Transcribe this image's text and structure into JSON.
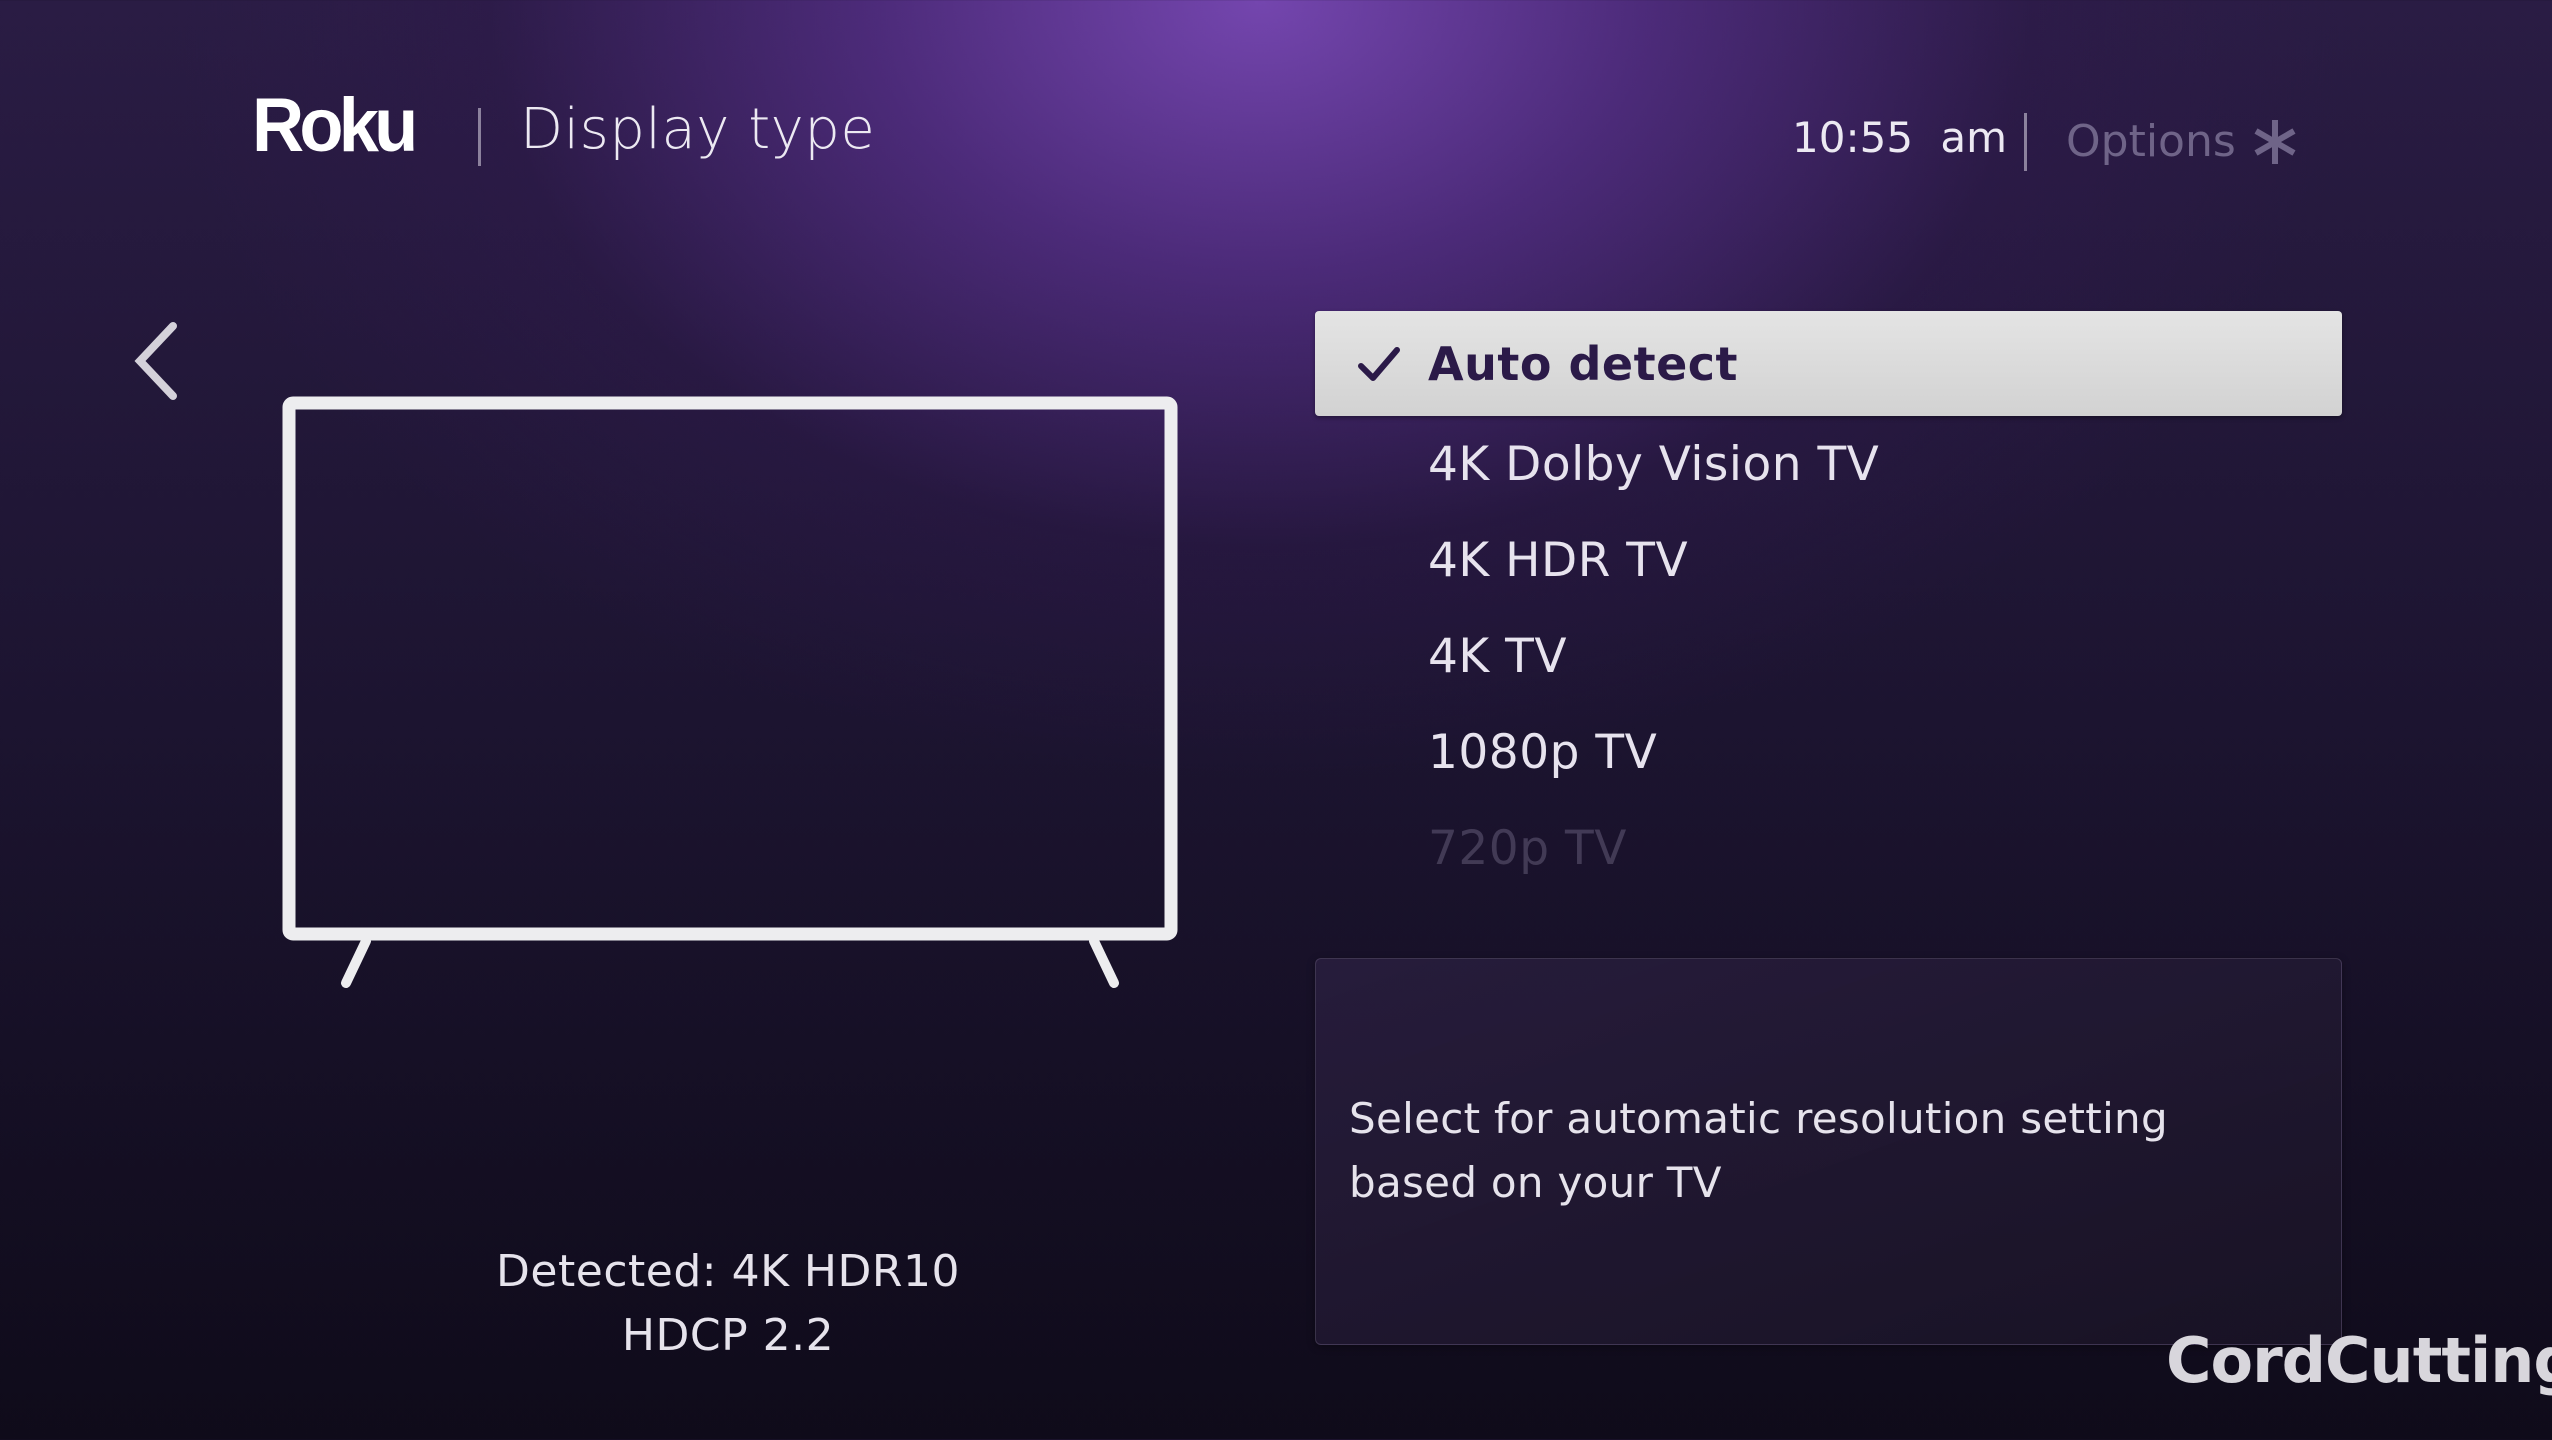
{
  "header": {
    "brand": "Roku",
    "title": "Display type",
    "time": "10:55 am",
    "options_label": "Options",
    "options_icon": "asterisk-icon"
  },
  "navigation": {
    "back_icon": "chevron-left-icon"
  },
  "display_types": {
    "selected_index": 0,
    "items": [
      {
        "label": "Auto detect",
        "checked": true
      },
      {
        "label": "4K Dolby Vision TV",
        "checked": false
      },
      {
        "label": "4K HDR TV",
        "checked": false
      },
      {
        "label": "4K TV",
        "checked": false
      },
      {
        "label": "1080p TV",
        "checked": false
      },
      {
        "label": "720p TV",
        "checked": false
      }
    ]
  },
  "description": {
    "text": "Select for automatic resolution setting based on your TV"
  },
  "detected": {
    "line1": "Detected: 4K HDR10",
    "line2": "HDCP 2.2"
  },
  "watermark": {
    "text": "CordCutting",
    "trademark": "™"
  },
  "colors": {
    "background_accent": "#7848b4",
    "selected_row_bg": "#dcdcdc",
    "selected_text": "#2b1a48",
    "options_text": "#6f6488"
  }
}
